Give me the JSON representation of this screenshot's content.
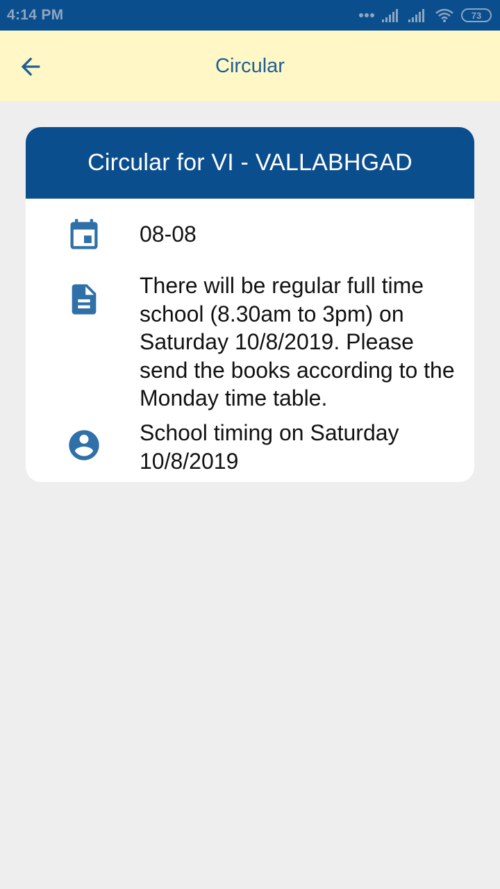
{
  "status_bar": {
    "time": "4:14 PM",
    "battery": "73"
  },
  "app_bar": {
    "title": "Circular"
  },
  "card": {
    "header": "Circular for VI - VALLABHGAD",
    "date": "08-08",
    "description": "There will be regular full time school (8.30am to 3pm) on Saturday 10/8/2019. Please send the books according to the Monday time table.",
    "subject": "School timing on Saturday 10/8/2019"
  },
  "colors": {
    "primary": "#0b4e8e",
    "app_bar_bg": "#fff8c6",
    "icon": "#2f70a8",
    "page_bg": "#eeeeee"
  },
  "icons": {
    "back": "arrow-back-icon",
    "date": "calendar-icon",
    "description": "document-icon",
    "subject": "account-circle-icon"
  }
}
